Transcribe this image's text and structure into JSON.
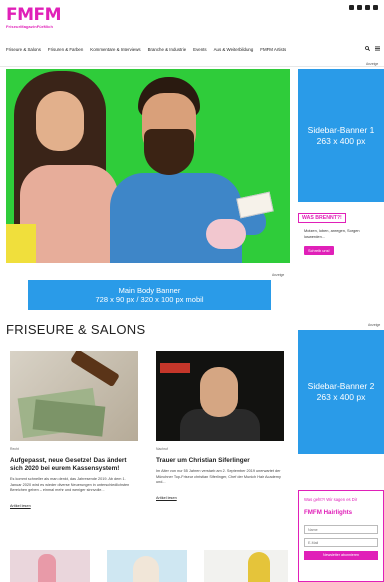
{
  "header": {
    "logo_main": "FMFM",
    "logo_sub": "FriseurMagazinFürMich",
    "social_icons": [
      "facebook-icon",
      "youtube-icon",
      "instagram-icon",
      "pinterest-icon"
    ]
  },
  "nav": {
    "items": [
      "Friseure & Salons",
      "Frisuren & Farben",
      "Kommentare & Interviews",
      "Branche & Industrie",
      "Events",
      "Aus & Weiterbildung",
      "FMFM Artists"
    ],
    "icons": [
      "search-icon",
      "menu-icon"
    ]
  },
  "ads": {
    "label": "Anzeige",
    "sidebar_banner_1": {
      "title": "Sidebar-Banner 1",
      "size": "263 x 400 px"
    },
    "sidebar_banner_2": {
      "title": "Sidebar-Banner 2",
      "size": "263 x 400 px"
    },
    "main_banner": {
      "title": "Main Body Banner",
      "size": "728 x 90 px / 320 x 100 px mobil"
    }
  },
  "was_brennt": {
    "title": "WAS BRENNT?!",
    "text": "Motzen, loben, anregen, Sorgen loswerden...",
    "button": "Schreib uns!"
  },
  "section": {
    "title": "FRISEURE & SALONS"
  },
  "articles": [
    {
      "category": "Recht",
      "title": "Aufgepasst, neue Gesetze! Das ändert sich 2020 bei eurem Kassensystem!",
      "excerpt": "Es kommt schneller als man denkt, das Jahresende 2019. Ab dem 1. Januar 2020 wird es wieder diverse Neuerungen in unterschiedlichsten Bereichen geben – einmal mehr und weniger sinnvolle...",
      "more": "Artikel lesen"
    },
    {
      "category": "Nachruf",
      "title": "Trauer um Christian Siferlinger",
      "excerpt": "Im Alter von nur 55 Jahren verstarb am 2. September 2019 unerwartet der Münchner Top-Friseur christian Siferlinger, Chef der Munich Hair Academy und...",
      "more": "Artikel lesen"
    }
  ],
  "newsletter": {
    "question": "Was geht?! Wir sagen es Dir",
    "heading": "FMFM Hairlights",
    "name_placeholder": "Name",
    "email_placeholder": "E-Mail",
    "button": "Newsletter abonnieren"
  },
  "colors": {
    "brand": "#e020b8",
    "banner": "#2a9be8",
    "hero_bg": "#2fcc3a"
  }
}
